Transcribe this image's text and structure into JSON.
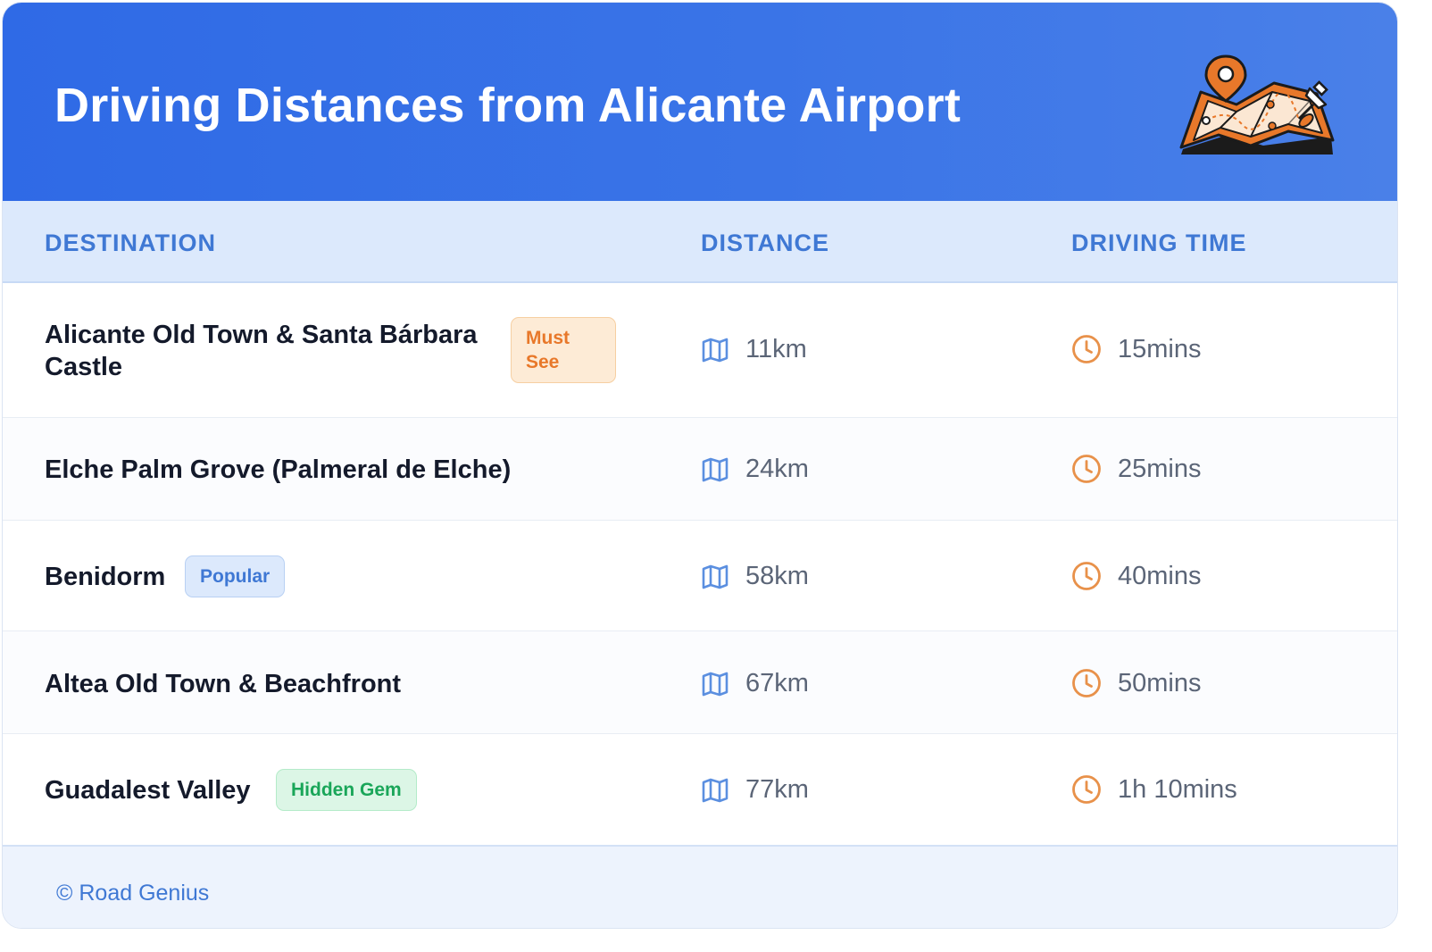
{
  "header": {
    "title": "Driving Distances from Alicante Airport"
  },
  "table": {
    "columns": [
      "DESTINATION",
      "DISTANCE",
      "DRIVING TIME"
    ],
    "rows": [
      {
        "destination": "Alicante Old Town & Santa Bárbara Castle",
        "badge": "Must See",
        "distance": "11km",
        "time": "15mins"
      },
      {
        "destination": "Elche Palm Grove (Palmeral de Elche)",
        "badge": "",
        "distance": "24km",
        "time": "25mins"
      },
      {
        "destination": "Benidorm",
        "badge": "Popular",
        "distance": "58km",
        "time": "40mins"
      },
      {
        "destination": "Altea Old Town & Beachfront",
        "badge": "",
        "distance": "67km",
        "time": "50mins"
      },
      {
        "destination": "Guadalest Valley",
        "badge": "Hidden Gem",
        "distance": "77km",
        "time": "1h 10mins"
      }
    ]
  },
  "icons": {
    "distance": "map-icon",
    "time": "clock-icon",
    "header": "map-with-pin-illustration"
  },
  "colors": {
    "header_blue": "#2f6ae6",
    "accent_blue": "#3f78d4",
    "orange": "#e8782a",
    "green": "#1aa659"
  },
  "footer": {
    "credit": "© Road Genius"
  }
}
